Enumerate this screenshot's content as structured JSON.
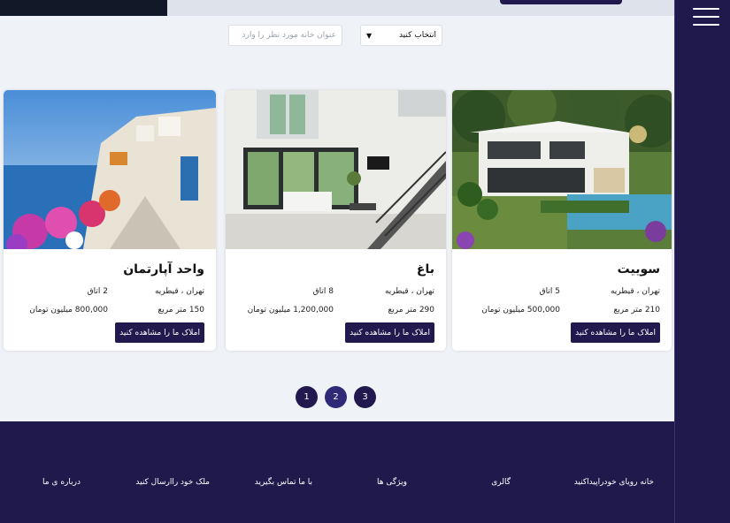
{
  "search": {
    "placeholder": "عنوان خانه مورد نظر را وارد",
    "select_value": "انتخاب کنید"
  },
  "cards": [
    {
      "title": "سوییت",
      "location": "تهران ، قیطریه",
      "rooms": "5 اتاق",
      "area": "210 متر مربع",
      "price": "500,000 میلیون تومان",
      "button": "املاک ما را مشاهده کنید"
    },
    {
      "title": "باغ",
      "location": "تهران ، قیطریه",
      "rooms": "8 اتاق",
      "area": "290 متر مربع",
      "price": "1,200,000 میلیون تومان",
      "button": "املاک ما را مشاهده کنید"
    },
    {
      "title": "واحد آپارتمان",
      "location": "تهران ، قیطریه",
      "rooms": "2 اتاق",
      "area": "150 متر مربع",
      "price": "800,000 میلیون تومان",
      "button": "املاک ما را مشاهده کنید"
    }
  ],
  "pagination": [
    "1",
    "2",
    "3"
  ],
  "footer": {
    "dream_home": "خانه رویای خودراپیداکنید",
    "gallery": "گالری",
    "features": "ویژگی ها",
    "contact": "با ما تماس بگیرید",
    "send_property": "ملک خود راارسال کنید",
    "about": "درباره ی ما"
  },
  "colors": {
    "brand": "#221a4e",
    "footer": "#1f1a4b",
    "page_bg": "#eff2f6"
  }
}
